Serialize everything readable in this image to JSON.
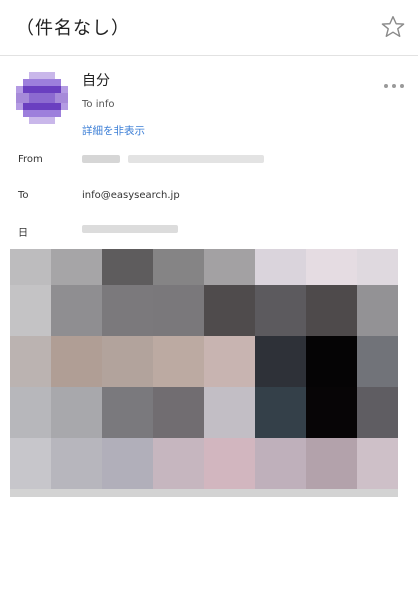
{
  "header": {
    "subject": "（件名なし）",
    "star_icon": "star-outline-icon"
  },
  "message": {
    "sender": "自分",
    "to_summary": "To info",
    "details_toggle": "詳細を非表示",
    "more_icon": "ellipsis-icon"
  },
  "meta": {
    "from_label": "From",
    "to_label": "To",
    "to_value": "info@easysearch.jp",
    "date_label": "日"
  },
  "colors": {
    "link": "#3d7fd6",
    "avatar": "#6a3fc0"
  }
}
